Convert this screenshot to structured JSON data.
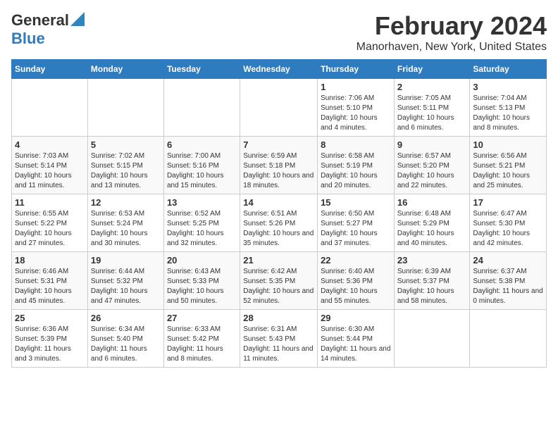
{
  "logo": {
    "line1": "General",
    "line2": "Blue"
  },
  "title": "February 2024",
  "subtitle": "Manorhaven, New York, United States",
  "days_of_week": [
    "Sunday",
    "Monday",
    "Tuesday",
    "Wednesday",
    "Thursday",
    "Friday",
    "Saturday"
  ],
  "weeks": [
    [
      {
        "day": "",
        "detail": ""
      },
      {
        "day": "",
        "detail": ""
      },
      {
        "day": "",
        "detail": ""
      },
      {
        "day": "",
        "detail": ""
      },
      {
        "day": "1",
        "detail": "Sunrise: 7:06 AM\nSunset: 5:10 PM\nDaylight: 10 hours\nand 4 minutes."
      },
      {
        "day": "2",
        "detail": "Sunrise: 7:05 AM\nSunset: 5:11 PM\nDaylight: 10 hours\nand 6 minutes."
      },
      {
        "day": "3",
        "detail": "Sunrise: 7:04 AM\nSunset: 5:13 PM\nDaylight: 10 hours\nand 8 minutes."
      }
    ],
    [
      {
        "day": "4",
        "detail": "Sunrise: 7:03 AM\nSunset: 5:14 PM\nDaylight: 10 hours\nand 11 minutes."
      },
      {
        "day": "5",
        "detail": "Sunrise: 7:02 AM\nSunset: 5:15 PM\nDaylight: 10 hours\nand 13 minutes."
      },
      {
        "day": "6",
        "detail": "Sunrise: 7:00 AM\nSunset: 5:16 PM\nDaylight: 10 hours\nand 15 minutes."
      },
      {
        "day": "7",
        "detail": "Sunrise: 6:59 AM\nSunset: 5:18 PM\nDaylight: 10 hours\nand 18 minutes."
      },
      {
        "day": "8",
        "detail": "Sunrise: 6:58 AM\nSunset: 5:19 PM\nDaylight: 10 hours\nand 20 minutes."
      },
      {
        "day": "9",
        "detail": "Sunrise: 6:57 AM\nSunset: 5:20 PM\nDaylight: 10 hours\nand 22 minutes."
      },
      {
        "day": "10",
        "detail": "Sunrise: 6:56 AM\nSunset: 5:21 PM\nDaylight: 10 hours\nand 25 minutes."
      }
    ],
    [
      {
        "day": "11",
        "detail": "Sunrise: 6:55 AM\nSunset: 5:22 PM\nDaylight: 10 hours\nand 27 minutes."
      },
      {
        "day": "12",
        "detail": "Sunrise: 6:53 AM\nSunset: 5:24 PM\nDaylight: 10 hours\nand 30 minutes."
      },
      {
        "day": "13",
        "detail": "Sunrise: 6:52 AM\nSunset: 5:25 PM\nDaylight: 10 hours\nand 32 minutes."
      },
      {
        "day": "14",
        "detail": "Sunrise: 6:51 AM\nSunset: 5:26 PM\nDaylight: 10 hours\nand 35 minutes."
      },
      {
        "day": "15",
        "detail": "Sunrise: 6:50 AM\nSunset: 5:27 PM\nDaylight: 10 hours\nand 37 minutes."
      },
      {
        "day": "16",
        "detail": "Sunrise: 6:48 AM\nSunset: 5:29 PM\nDaylight: 10 hours\nand 40 minutes."
      },
      {
        "day": "17",
        "detail": "Sunrise: 6:47 AM\nSunset: 5:30 PM\nDaylight: 10 hours\nand 42 minutes."
      }
    ],
    [
      {
        "day": "18",
        "detail": "Sunrise: 6:46 AM\nSunset: 5:31 PM\nDaylight: 10 hours\nand 45 minutes."
      },
      {
        "day": "19",
        "detail": "Sunrise: 6:44 AM\nSunset: 5:32 PM\nDaylight: 10 hours\nand 47 minutes."
      },
      {
        "day": "20",
        "detail": "Sunrise: 6:43 AM\nSunset: 5:33 PM\nDaylight: 10 hours\nand 50 minutes."
      },
      {
        "day": "21",
        "detail": "Sunrise: 6:42 AM\nSunset: 5:35 PM\nDaylight: 10 hours\nand 52 minutes."
      },
      {
        "day": "22",
        "detail": "Sunrise: 6:40 AM\nSunset: 5:36 PM\nDaylight: 10 hours\nand 55 minutes."
      },
      {
        "day": "23",
        "detail": "Sunrise: 6:39 AM\nSunset: 5:37 PM\nDaylight: 10 hours\nand 58 minutes."
      },
      {
        "day": "24",
        "detail": "Sunrise: 6:37 AM\nSunset: 5:38 PM\nDaylight: 11 hours\nand 0 minutes."
      }
    ],
    [
      {
        "day": "25",
        "detail": "Sunrise: 6:36 AM\nSunset: 5:39 PM\nDaylight: 11 hours\nand 3 minutes."
      },
      {
        "day": "26",
        "detail": "Sunrise: 6:34 AM\nSunset: 5:40 PM\nDaylight: 11 hours\nand 6 minutes."
      },
      {
        "day": "27",
        "detail": "Sunrise: 6:33 AM\nSunset: 5:42 PM\nDaylight: 11 hours\nand 8 minutes."
      },
      {
        "day": "28",
        "detail": "Sunrise: 6:31 AM\nSunset: 5:43 PM\nDaylight: 11 hours\nand 11 minutes."
      },
      {
        "day": "29",
        "detail": "Sunrise: 6:30 AM\nSunset: 5:44 PM\nDaylight: 11 hours\nand 14 minutes."
      },
      {
        "day": "",
        "detail": ""
      },
      {
        "day": "",
        "detail": ""
      }
    ]
  ]
}
